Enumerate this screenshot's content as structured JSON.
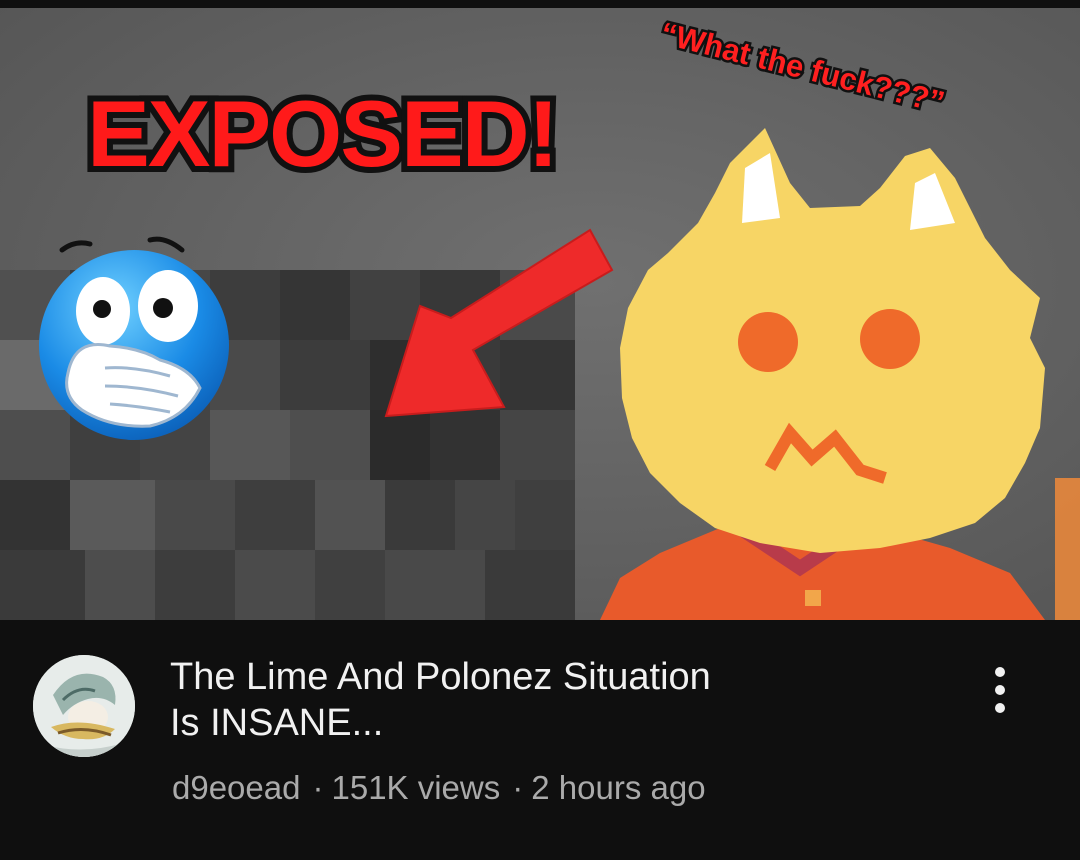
{
  "thumbnail": {
    "headline": "EXPOSED!",
    "quote": "“What the fuck???”",
    "icons": [
      "shocked-emoji-icon",
      "red-arrow-icon",
      "pixel-cat-icon"
    ],
    "colors": {
      "headline": "#ff1a1a",
      "arrow": "#ee2a2a",
      "cat": "#f7d565",
      "shirt": "#e85a2b"
    }
  },
  "video": {
    "title_line1": "The Lime And Polonez Situation",
    "title_line2": "Is INSANE...",
    "channel": "d9eoead",
    "views": "151K views",
    "age": "2 hours ago",
    "separator": "·"
  },
  "menu_icon": "more-vert-icon"
}
